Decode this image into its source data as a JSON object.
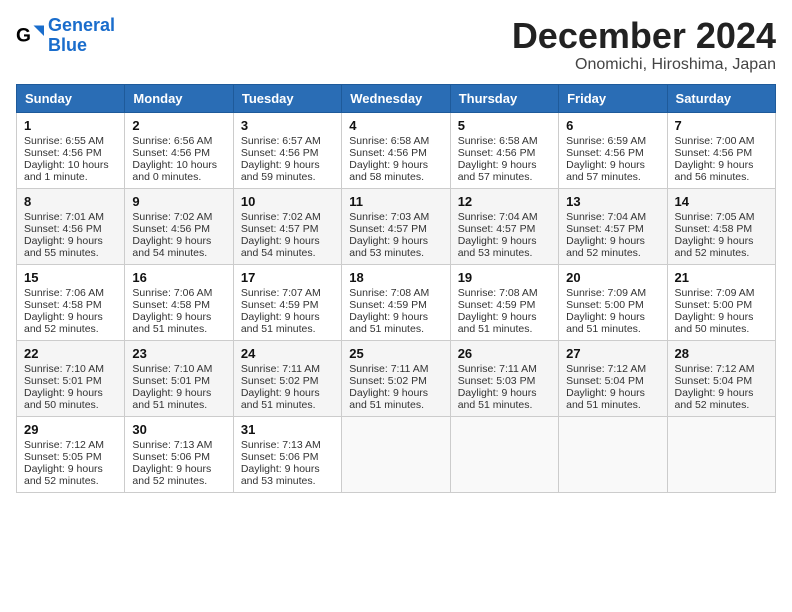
{
  "logo": {
    "line1": "General",
    "line2": "Blue"
  },
  "title": "December 2024",
  "location": "Onomichi, Hiroshima, Japan",
  "days_of_week": [
    "Sunday",
    "Monday",
    "Tuesday",
    "Wednesday",
    "Thursday",
    "Friday",
    "Saturday"
  ],
  "weeks": [
    [
      {
        "day": 1,
        "sunrise": "6:55 AM",
        "sunset": "4:56 PM",
        "daylight": "10 hours and 1 minute."
      },
      {
        "day": 2,
        "sunrise": "6:56 AM",
        "sunset": "4:56 PM",
        "daylight": "10 hours and 0 minutes."
      },
      {
        "day": 3,
        "sunrise": "6:57 AM",
        "sunset": "4:56 PM",
        "daylight": "9 hours and 59 minutes."
      },
      {
        "day": 4,
        "sunrise": "6:58 AM",
        "sunset": "4:56 PM",
        "daylight": "9 hours and 58 minutes."
      },
      {
        "day": 5,
        "sunrise": "6:58 AM",
        "sunset": "4:56 PM",
        "daylight": "9 hours and 57 minutes."
      },
      {
        "day": 6,
        "sunrise": "6:59 AM",
        "sunset": "4:56 PM",
        "daylight": "9 hours and 57 minutes."
      },
      {
        "day": 7,
        "sunrise": "7:00 AM",
        "sunset": "4:56 PM",
        "daylight": "9 hours and 56 minutes."
      }
    ],
    [
      {
        "day": 8,
        "sunrise": "7:01 AM",
        "sunset": "4:56 PM",
        "daylight": "9 hours and 55 minutes."
      },
      {
        "day": 9,
        "sunrise": "7:02 AM",
        "sunset": "4:56 PM",
        "daylight": "9 hours and 54 minutes."
      },
      {
        "day": 10,
        "sunrise": "7:02 AM",
        "sunset": "4:57 PM",
        "daylight": "9 hours and 54 minutes."
      },
      {
        "day": 11,
        "sunrise": "7:03 AM",
        "sunset": "4:57 PM",
        "daylight": "9 hours and 53 minutes."
      },
      {
        "day": 12,
        "sunrise": "7:04 AM",
        "sunset": "4:57 PM",
        "daylight": "9 hours and 53 minutes."
      },
      {
        "day": 13,
        "sunrise": "7:04 AM",
        "sunset": "4:57 PM",
        "daylight": "9 hours and 52 minutes."
      },
      {
        "day": 14,
        "sunrise": "7:05 AM",
        "sunset": "4:58 PM",
        "daylight": "9 hours and 52 minutes."
      }
    ],
    [
      {
        "day": 15,
        "sunrise": "7:06 AM",
        "sunset": "4:58 PM",
        "daylight": "9 hours and 52 minutes."
      },
      {
        "day": 16,
        "sunrise": "7:06 AM",
        "sunset": "4:58 PM",
        "daylight": "9 hours and 51 minutes."
      },
      {
        "day": 17,
        "sunrise": "7:07 AM",
        "sunset": "4:59 PM",
        "daylight": "9 hours and 51 minutes."
      },
      {
        "day": 18,
        "sunrise": "7:08 AM",
        "sunset": "4:59 PM",
        "daylight": "9 hours and 51 minutes."
      },
      {
        "day": 19,
        "sunrise": "7:08 AM",
        "sunset": "4:59 PM",
        "daylight": "9 hours and 51 minutes."
      },
      {
        "day": 20,
        "sunrise": "7:09 AM",
        "sunset": "5:00 PM",
        "daylight": "9 hours and 51 minutes."
      },
      {
        "day": 21,
        "sunrise": "7:09 AM",
        "sunset": "5:00 PM",
        "daylight": "9 hours and 50 minutes."
      }
    ],
    [
      {
        "day": 22,
        "sunrise": "7:10 AM",
        "sunset": "5:01 PM",
        "daylight": "9 hours and 50 minutes."
      },
      {
        "day": 23,
        "sunrise": "7:10 AM",
        "sunset": "5:01 PM",
        "daylight": "9 hours and 51 minutes."
      },
      {
        "day": 24,
        "sunrise": "7:11 AM",
        "sunset": "5:02 PM",
        "daylight": "9 hours and 51 minutes."
      },
      {
        "day": 25,
        "sunrise": "7:11 AM",
        "sunset": "5:02 PM",
        "daylight": "9 hours and 51 minutes."
      },
      {
        "day": 26,
        "sunrise": "7:11 AM",
        "sunset": "5:03 PM",
        "daylight": "9 hours and 51 minutes."
      },
      {
        "day": 27,
        "sunrise": "7:12 AM",
        "sunset": "5:04 PM",
        "daylight": "9 hours and 51 minutes."
      },
      {
        "day": 28,
        "sunrise": "7:12 AM",
        "sunset": "5:04 PM",
        "daylight": "9 hours and 52 minutes."
      }
    ],
    [
      {
        "day": 29,
        "sunrise": "7:12 AM",
        "sunset": "5:05 PM",
        "daylight": "9 hours and 52 minutes."
      },
      {
        "day": 30,
        "sunrise": "7:13 AM",
        "sunset": "5:06 PM",
        "daylight": "9 hours and 52 minutes."
      },
      {
        "day": 31,
        "sunrise": "7:13 AM",
        "sunset": "5:06 PM",
        "daylight": "9 hours and 53 minutes."
      },
      null,
      null,
      null,
      null
    ]
  ]
}
